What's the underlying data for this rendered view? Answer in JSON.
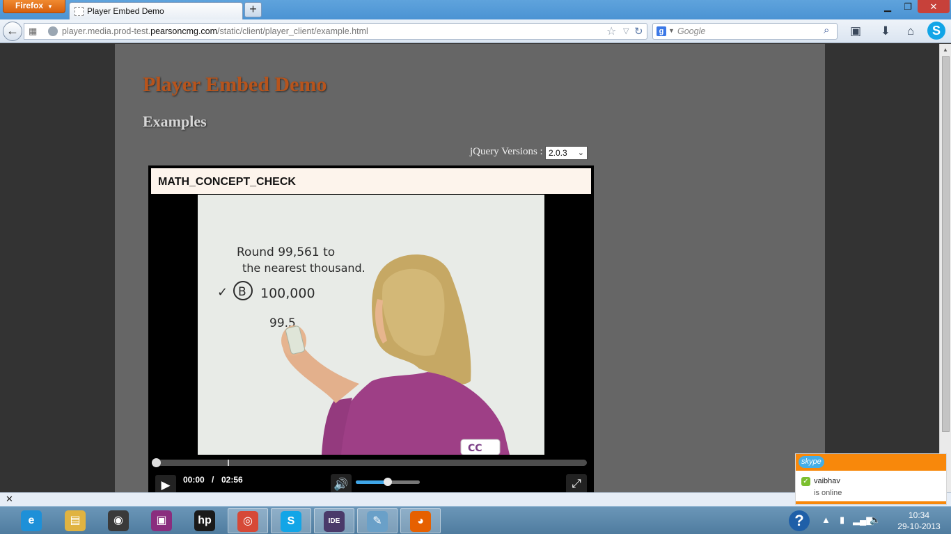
{
  "browser": {
    "menu_label": "Firefox",
    "tab_title": "Player Embed Demo",
    "new_tab_symbol": "+",
    "url_prefix": "player.media.prod-test.",
    "url_domain": "pearsoncmg.com",
    "url_path": "/static/client/player_client/example.html",
    "search_placeholder": "Google"
  },
  "page": {
    "title": "Player Embed Demo",
    "subtitle": "Examples",
    "jquery_label": "jQuery Versions :",
    "jquery_selected": "2.0.3"
  },
  "player": {
    "title": "MATH_CONCEPT_CHECK",
    "video_text": {
      "line1": "Round 99,561 to",
      "line2": "the nearest thousand.",
      "choice_letter": "B",
      "choice_value": "100,000",
      "work": "99.5",
      "badge": "CC"
    },
    "time_current": "00:00",
    "time_separator": "/",
    "time_duration": "02:56",
    "progress": 0.0,
    "buffered_mark": 0.17,
    "volume": 0.5
  },
  "skype_toast": {
    "logo": "skype",
    "contact": "vaibhav",
    "status": "is online"
  },
  "taskbar": {
    "items": [
      {
        "name": "internet-explorer",
        "glyph": "e",
        "color": "#1e90d8"
      },
      {
        "name": "file-explorer",
        "glyph": "▤",
        "color": "#e0b341"
      },
      {
        "name": "media-player",
        "glyph": "◉",
        "color": "#3a3a3a"
      },
      {
        "name": "app-purple",
        "glyph": "▣",
        "color": "#8a2d7e"
      },
      {
        "name": "hp",
        "glyph": "hp",
        "color": "#1a1a1a"
      },
      {
        "name": "chrome",
        "glyph": "◎",
        "color": "#d64937"
      },
      {
        "name": "skype",
        "glyph": "S",
        "color": "#12a5e7"
      },
      {
        "name": "java-ee-ide",
        "glyph": "IDE",
        "color": "#4a3a6a"
      },
      {
        "name": "notepad",
        "glyph": "✎",
        "color": "#6aa0c8"
      },
      {
        "name": "firefox",
        "glyph": "◕",
        "color": "#e66000"
      }
    ],
    "clock_time": "10:34",
    "clock_date": "29-10-2013"
  },
  "colors": {
    "accent_title": "#b7541c",
    "page_background": "#666666",
    "player_header": "#fdf4ec",
    "volume_fill": "#3fa6e8",
    "skype_orange": "#f8880b"
  }
}
